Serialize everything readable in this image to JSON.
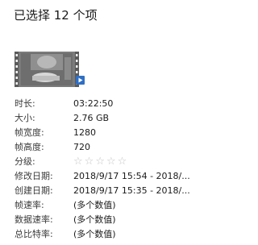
{
  "header": {
    "title": "已选择 12 个项"
  },
  "thumbnail": {
    "icon": "video-file-icon",
    "play_badge_icon": "play-icon",
    "badge_color": "#2f6fc4"
  },
  "properties": [
    {
      "label": "时长:",
      "value": "03:22:50",
      "name": "duration"
    },
    {
      "label": "大小:",
      "value": "2.76 GB",
      "name": "size"
    },
    {
      "label": "帧宽度:",
      "value": "1280",
      "name": "frame-width"
    },
    {
      "label": "帧高度:",
      "value": "720",
      "name": "frame-height"
    },
    {
      "label": "分级:",
      "value": "",
      "name": "rating",
      "stars_filled": 0,
      "stars_total": 5
    },
    {
      "label": "修改日期:",
      "value": "2018/9/17 15:54 - 2018/...",
      "name": "modified-date"
    },
    {
      "label": "创建日期:",
      "value": "2018/9/17 15:35 - 2018/...",
      "name": "created-date"
    },
    {
      "label": "帧速率:",
      "value": "(多个数值)",
      "name": "frame-rate"
    },
    {
      "label": "数据速率:",
      "value": "(多个数值)",
      "name": "data-rate"
    },
    {
      "label": "总比特率:",
      "value": "(多个数值)",
      "name": "total-bitrate"
    }
  ],
  "rating_star_glyph": "☆"
}
